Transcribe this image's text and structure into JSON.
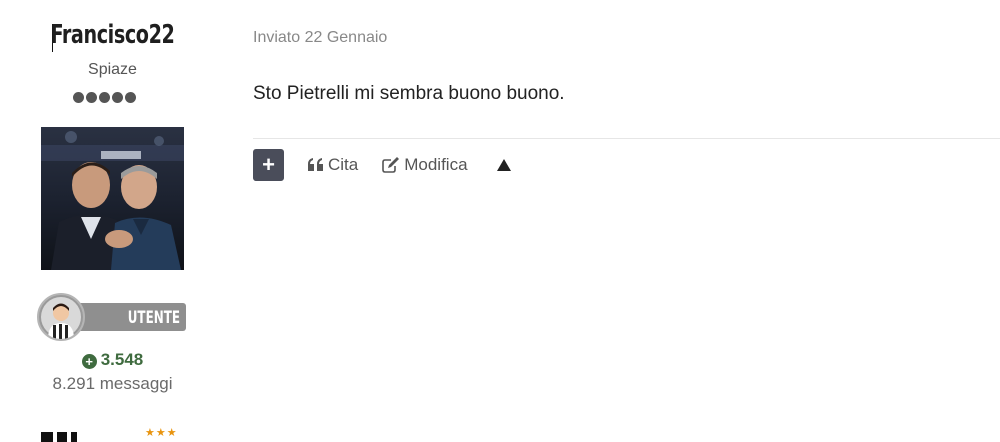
{
  "author": {
    "username": "Francisco22",
    "rank": "Spiaze",
    "rank_pips": 5,
    "badge": {
      "label": "UTENTE"
    },
    "reputation": "3.548",
    "message_count": "8.291 messaggi",
    "colors": {
      "reputation": "#3f6b3f",
      "badge": "#8f8f8f",
      "stars": "#e8940f"
    },
    "icons": [
      "plus-circle-icon",
      "user-avatar-icon",
      "star-icon"
    ]
  },
  "post": {
    "posted_label": "Inviato 22 Gennaio",
    "content": "Sto Pietrelli mi sembra buono buono.",
    "actions": {
      "plus_icon": "plus-icon",
      "quote_label": "Cita",
      "quote_icon": "quote-icon",
      "edit_label": "Modifica",
      "edit_icon": "edit-icon",
      "up_icon": "triangle-up-icon"
    }
  }
}
